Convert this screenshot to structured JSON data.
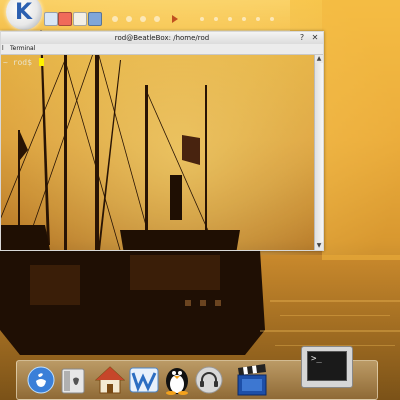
{
  "terminal": {
    "title": "rod@BeatleBox: /home/rod",
    "menu": [
      "l",
      "Terminal"
    ],
    "prompt": "~ rod$ ",
    "help_label": "?",
    "close_label": "✕",
    "scroll_up": "▲",
    "scroll_down": "▼"
  },
  "panel": {
    "k_menu_label": "K",
    "tray_icons": [
      "lock-icon",
      "power-icon",
      "home-icon",
      "network-icon"
    ]
  },
  "dock": {
    "items": [
      "finder-icon",
      "system-info-icon",
      "home-icon",
      "workspace-icon",
      "linux-penguin-icon",
      "audio-icon",
      "video-icon",
      "terminal-icon"
    ],
    "terminal_icon_text": ">_"
  }
}
